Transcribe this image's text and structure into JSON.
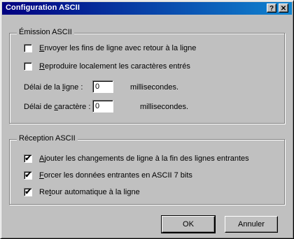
{
  "window": {
    "title": "Configuration ASCII",
    "help_glyph": "?",
    "close_glyph": "✕"
  },
  "emission": {
    "legend": "Émission ASCII",
    "options": [
      {
        "pre": "",
        "accel": "E",
        "post": "nvoyer les fins de ligne avec retour à la ligne",
        "checked": false
      },
      {
        "pre": "",
        "accel": "R",
        "post": "eproduire localement les caractères entrés",
        "checked": false
      }
    ],
    "line_delay": {
      "pre": "Délai de la ",
      "accel": "l",
      "post": "igne :",
      "value": "0",
      "unit": "millisecondes."
    },
    "char_delay": {
      "pre": "Délai de ",
      "accel": "c",
      "post": "aractère :",
      "value": "0",
      "unit": "millisecondes."
    }
  },
  "reception": {
    "legend": "Réception ASCII",
    "options": [
      {
        "pre": "",
        "accel": "A",
        "post": "jouter les changements de ligne à la fin des lignes entrantes",
        "checked": true
      },
      {
        "pre": "",
        "accel": "F",
        "post": "orcer les données entrantes en ASCII 7 bits",
        "checked": true
      },
      {
        "pre": "Re",
        "accel": "t",
        "post": "our automatique à la ligne",
        "checked": true
      }
    ]
  },
  "buttons": {
    "ok": "OK",
    "cancel": "Annuler"
  },
  "check_glyph": "✔"
}
